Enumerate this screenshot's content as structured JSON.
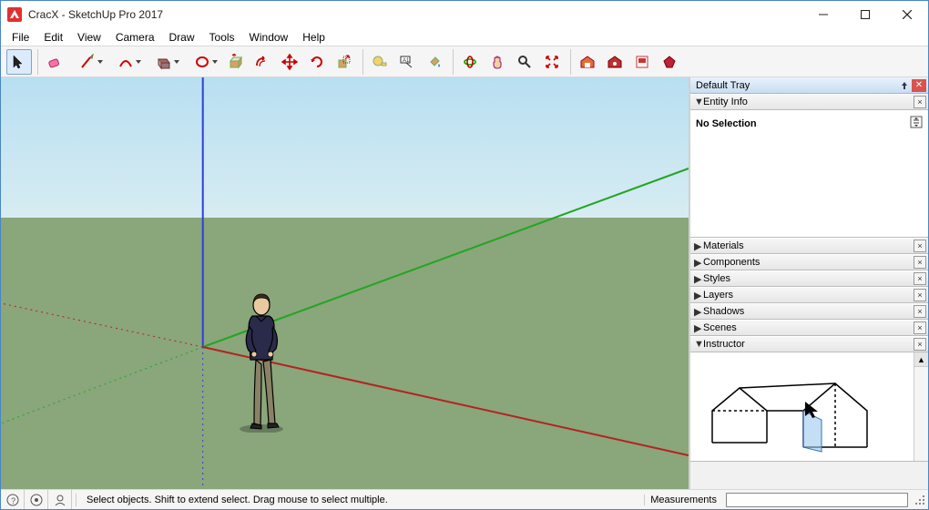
{
  "window": {
    "title": "CracX - SketchUp Pro 2017"
  },
  "menu": {
    "items": [
      "File",
      "Edit",
      "View",
      "Camera",
      "Draw",
      "Tools",
      "Window",
      "Help"
    ]
  },
  "tray": {
    "title": "Default Tray",
    "entity_panel": {
      "title": "Entity Info",
      "selection_text": "No Selection",
      "expanded": true
    },
    "panels": [
      {
        "title": "Materials",
        "expanded": false
      },
      {
        "title": "Components",
        "expanded": false
      },
      {
        "title": "Styles",
        "expanded": false
      },
      {
        "title": "Layers",
        "expanded": false
      },
      {
        "title": "Shadows",
        "expanded": false
      },
      {
        "title": "Scenes",
        "expanded": false
      }
    ],
    "instructor_panel": {
      "title": "Instructor",
      "expanded": true
    }
  },
  "status": {
    "hint": "Select objects. Shift to extend select. Drag mouse to select multiple.",
    "measurements_label": "Measurements"
  }
}
